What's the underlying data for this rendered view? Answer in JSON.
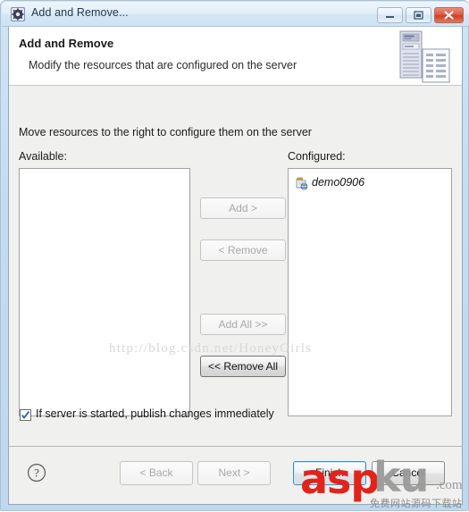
{
  "window": {
    "title": "Add and Remove...",
    "title_icon": "gear-icon",
    "controls": {
      "minimize": "minimize-icon",
      "maximize": "maximize-icon",
      "close": "close-icon"
    }
  },
  "banner": {
    "title": "Add and Remove",
    "description": "Modify the resources that are configured on the server",
    "icon": "server-and-document-icon"
  },
  "body": {
    "instruction": "Move resources to the right to configure them on the server",
    "available": {
      "label": "Available:",
      "items": []
    },
    "configured": {
      "label": "Configured:",
      "items": [
        {
          "name": "demo0906",
          "icon": "web-module-icon"
        }
      ]
    },
    "transfer_buttons": [
      {
        "label": "Add >",
        "enabled": false
      },
      {
        "label": "< Remove",
        "enabled": false
      },
      {
        "label": "Add All >>",
        "enabled": false
      },
      {
        "label": "<< Remove All",
        "enabled": true
      }
    ],
    "publish_option": {
      "label": "If server is started, publish changes immediately",
      "checked": true
    }
  },
  "footer": {
    "help_icon": "question-mark-icon",
    "buttons": [
      {
        "label": "< Back",
        "enabled": false,
        "default": false
      },
      {
        "label": "Next >",
        "enabled": false,
        "default": false
      },
      {
        "label": "Finish",
        "enabled": true,
        "default": true
      },
      {
        "label": "Cancel",
        "enabled": true,
        "default": false
      }
    ]
  },
  "watermarks": {
    "csdn": "http://blog.csdn.net/HoneyGirls",
    "aspku_red": "asp",
    "aspku_gray": "ku",
    "aspku_tld": ".com",
    "aspku_cn": "免费网站源码下载站"
  },
  "colors": {
    "accent": "#3c8ec4",
    "close_button": "#cf3f27",
    "dialog_background": "#f0f0ef",
    "watermark_red": "#e2231a"
  }
}
